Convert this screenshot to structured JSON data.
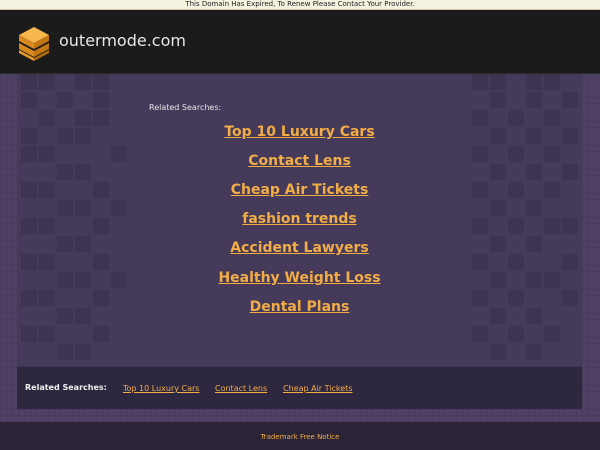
{
  "notice": {
    "text": "This Domain Has Expired, To Renew Please Contact Your Provider."
  },
  "header": {
    "site_name": "outermode.com",
    "logo_icon": "stacked-boxes-icon"
  },
  "main": {
    "related_label": "Related Searches:",
    "links": [
      "Top 10 Luxury Cars",
      "Contact Lens",
      "Cheap Air Tickets",
      "fashion trends",
      "Accident Lawyers",
      "Healthy Weight Loss",
      "Dental Plans"
    ]
  },
  "bottom": {
    "label": "Related Searches:",
    "links": [
      "Top 10 Luxury Cars",
      "Contact Lens",
      "Cheap Air Tickets"
    ]
  },
  "footer": {
    "link": "Trademark Free Notice"
  },
  "colors": {
    "accent": "#f2ad45",
    "header_bg": "#1b1b1b",
    "panel_bg": "#463a5b"
  }
}
